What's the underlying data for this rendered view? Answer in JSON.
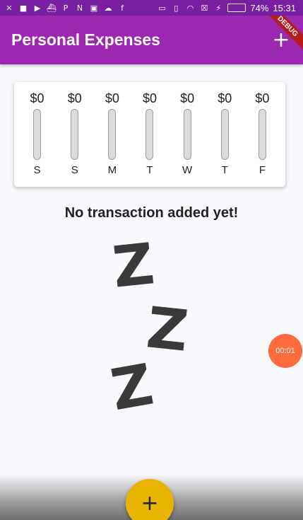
{
  "status_bar": {
    "icons_left": [
      "x-app-icon",
      "video-icon",
      "youtube-icon",
      "ship-icon",
      "p-app-icon",
      "n-app-icon",
      "shopping-icon",
      "cloud-icon",
      "facebook-icon"
    ],
    "icons_right": [
      "cast-icon",
      "vibrate-icon",
      "wifi-icon",
      "no-sim-icon",
      "flash-icon"
    ],
    "battery_percent": "74%",
    "battery_level": 0.74,
    "time": "15:31"
  },
  "app_bar": {
    "title": "Personal Expenses",
    "add_icon": "+"
  },
  "debug_banner": "DEBUG",
  "chart": {
    "days": [
      {
        "day": "S",
        "amount": "$0",
        "fill": 0
      },
      {
        "day": "S",
        "amount": "$0",
        "fill": 0
      },
      {
        "day": "M",
        "amount": "$0",
        "fill": 0
      },
      {
        "day": "T",
        "amount": "$0",
        "fill": 0
      },
      {
        "day": "W",
        "amount": "$0",
        "fill": 0
      },
      {
        "day": "T",
        "amount": "$0",
        "fill": 0
      },
      {
        "day": "F",
        "amount": "$0",
        "fill": 0
      }
    ]
  },
  "empty_state": {
    "title": "No transaction added yet!",
    "illustration": "sleeping-zzz-image"
  },
  "timer_bubble": "00:01",
  "fab": {
    "icon": "+"
  },
  "colors": {
    "primary": "#9c27b0",
    "primary_dark": "#7b1fa2",
    "accent": "#e8b400"
  }
}
